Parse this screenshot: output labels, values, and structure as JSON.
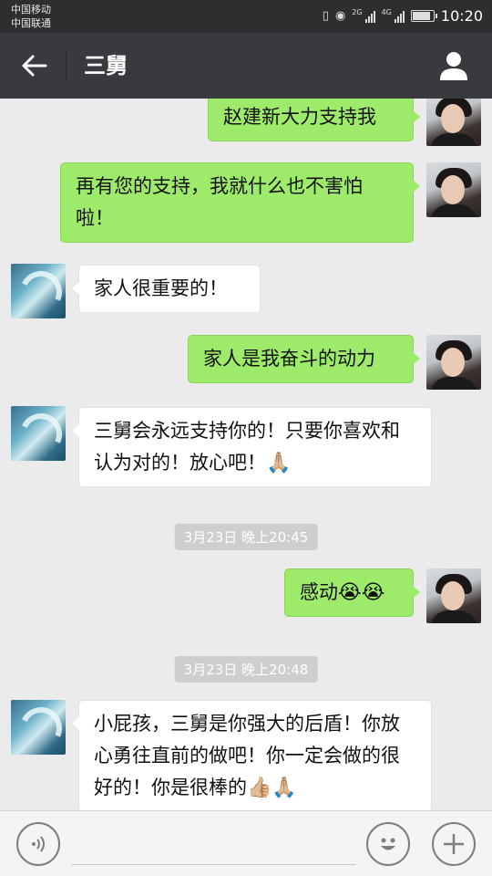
{
  "status_bar": {
    "carrier_1": "中国移动",
    "carrier_2": "中国联通",
    "network_2g": "2G",
    "network_4g": "4G",
    "time": "10:20"
  },
  "header": {
    "back_icon": "arrow-left-icon",
    "title": "三舅",
    "profile_icon": "person-icon"
  },
  "messages": [
    {
      "side": "out",
      "text": "赵建新大力支持我"
    },
    {
      "side": "out",
      "text": "再有您的支持，我就什么也不害怕啦！"
    },
    {
      "side": "in",
      "text": "家人很重要的！"
    },
    {
      "side": "out",
      "text": "家人是我奋斗的动力"
    },
    {
      "side": "in",
      "text": "三舅会永远支持你的！只要你喜欢和认为对的！放心吧！",
      "emoji": "🙏🏼"
    },
    {
      "side": "out",
      "text": "感动",
      "emoji": "😭😭"
    },
    {
      "side": "in",
      "text": "小屁孩，三舅是你强大的后盾！你放心勇往直前的做吧！你一定会做的很好的！你是很棒的",
      "emoji": "👍🏼🙏🏼"
    }
  ],
  "timestamps": [
    "3月23日 晚上20:45",
    "3月23日 晚上20:48"
  ],
  "input_bar": {
    "voice_icon": "voice-icon",
    "emoji_icon": "smiley-icon",
    "more_icon": "plus-icon"
  },
  "colors": {
    "outgoing_bubble": "#9eea6a",
    "incoming_bubble": "#ffffff",
    "header_bg": "#393a3f",
    "chat_bg": "#ebebeb"
  }
}
